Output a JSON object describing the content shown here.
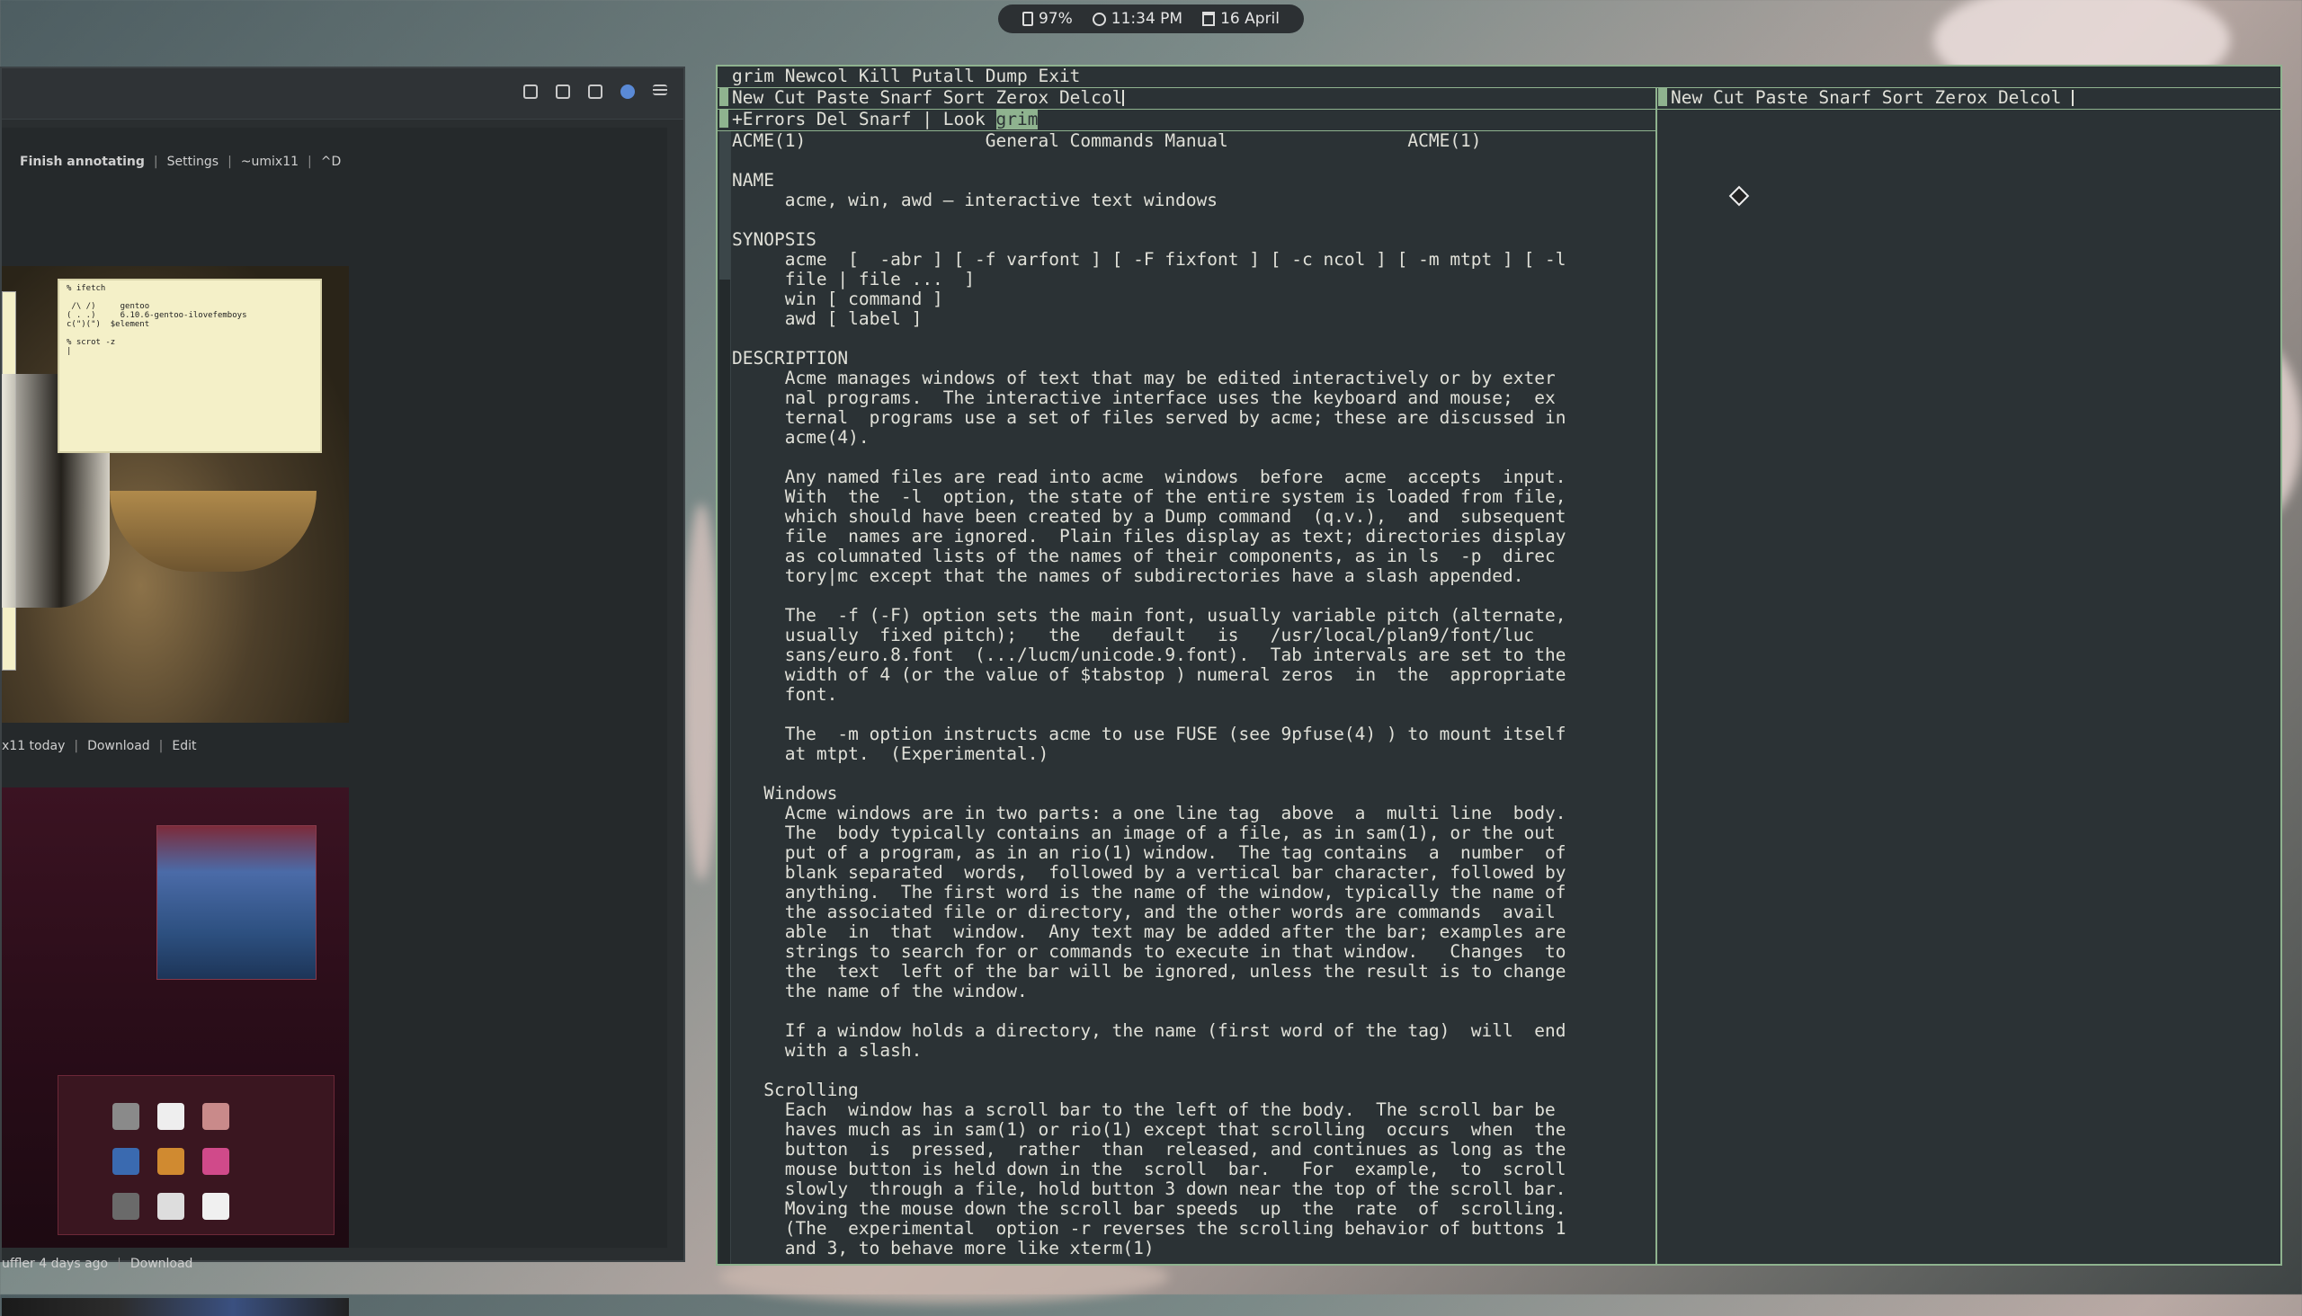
{
  "status_bar": {
    "battery": "97%",
    "time": "11:34 PM",
    "date": "16 April",
    "icons": [
      "battery-icon",
      "clock-icon",
      "calendar-icon"
    ]
  },
  "left_window": {
    "toolbar_icons": [
      "share-icon",
      "archive-icon",
      "screen-icon",
      "extension-icon",
      "menu-icon"
    ],
    "post1_actions": [
      "Finish annotating",
      "Settings",
      "~umix11",
      "^D"
    ],
    "post1_footer": [
      "x11 today",
      "Download",
      "Edit"
    ],
    "post1_terminal": "% ifetch\n\n /\\ /)     gentoo\n( . .)     6.10.6-gentoo-ilovefemboys\nc(\")(\")  $element\n\n% scrot -z\n|",
    "post2_footer": [
      "uffler 4 days ago",
      "Download"
    ]
  },
  "acme": {
    "main_tag": "grim Newcol Kill Putall Dump Exit",
    "col1_tag": "New Cut Paste Snarf Sort Zerox Delcol",
    "col2_tag": "New Cut Paste Snarf Sort Zerox Delcol",
    "win_tag_prefix": "+Errors Del Snarf | Look ",
    "win_tag_selected": "grim",
    "body": "ACME(1)                 General Commands Manual                 ACME(1)\n\nNAME\n     acme, win, awd – interactive text windows\n\nSYNOPSIS\n     acme  [  -abr ] [ -f varfont ] [ -F fixfont ] [ -c ncol ] [ -m mtpt ] [ -l\n     file | file ...  ]\n     win [ command ]\n     awd [ label ]\n\nDESCRIPTION\n     Acme manages windows of text that may be edited interactively or by exter\n     nal programs.  The interactive interface uses the keyboard and mouse;  ex\n     ternal  programs use a set of files served by acme; these are discussed in\n     acme(4).\n\n     Any named files are read into acme  windows  before  acme  accepts  input.\n     With  the  -l  option, the state of the entire system is loaded from file,\n     which should have been created by a Dump command  (q.v.),  and  subsequent\n     file  names are ignored.  Plain files display as text; directories display\n     as columnated lists of the names of their components, as in ls  -p  direc\n     tory|mc except that the names of subdirectories have a slash appended.\n\n     The  -f (-F) option sets the main font, usually variable pitch (alternate,\n     usually  fixed pitch);   the   default   is   /usr/local/plan9/font/luc\n     sans/euro.8.font  (.../lucm/unicode.9.font).  Tab intervals are set to the\n     width of 4 (or the value of $tabstop ) numeral zeros  in  the  appropriate\n     font.\n\n     The  -m option instructs acme to use FUSE (see 9pfuse(4) ) to mount itself\n     at mtpt.  (Experimental.)\n\n   Windows\n     Acme windows are in two parts: a one line tag  above  a  multi line  body.\n     The  body typically contains an image of a file, as in sam(1), or the out\n     put of a program, as in an rio(1) window.  The tag contains  a  number  of\n     blank separated  words,  followed by a vertical bar character, followed by\n     anything.  The first word is the name of the window, typically the name of\n     the associated file or directory, and the other words are commands  avail\n     able  in  that  window.  Any text may be added after the bar; examples are\n     strings to search for or commands to execute in that window.   Changes  to\n     the  text  left of the bar will be ignored, unless the result is to change\n     the name of the window.\n\n     If a window holds a directory, the name (first word of the tag)  will  end\n     with a slash.\n\n   Scrolling\n     Each  window has a scroll bar to the left of the body.  The scroll bar be\n     haves much as in sam(1) or rio(1) except that scrolling  occurs  when  the\n     button  is  pressed,  rather  than  released, and continues as long as the\n     mouse button is held down in the  scroll  bar.   For  example,  to  scroll\n     slowly  through a file, hold button 3 down near the top of the scroll bar.\n     Moving the mouse down the scroll bar speeds  up  the  rate  of  scrolling.\n     (The  experimental  option -r reverses the scrolling behavior of buttons 1\n     and 3, to behave more like xterm(1)"
  },
  "colors": {
    "acme_bg": "#2b3235",
    "acme_text": "#e0e0d8",
    "acme_accent": "#8fb38f",
    "statusbar_bg": "#2c3033"
  }
}
